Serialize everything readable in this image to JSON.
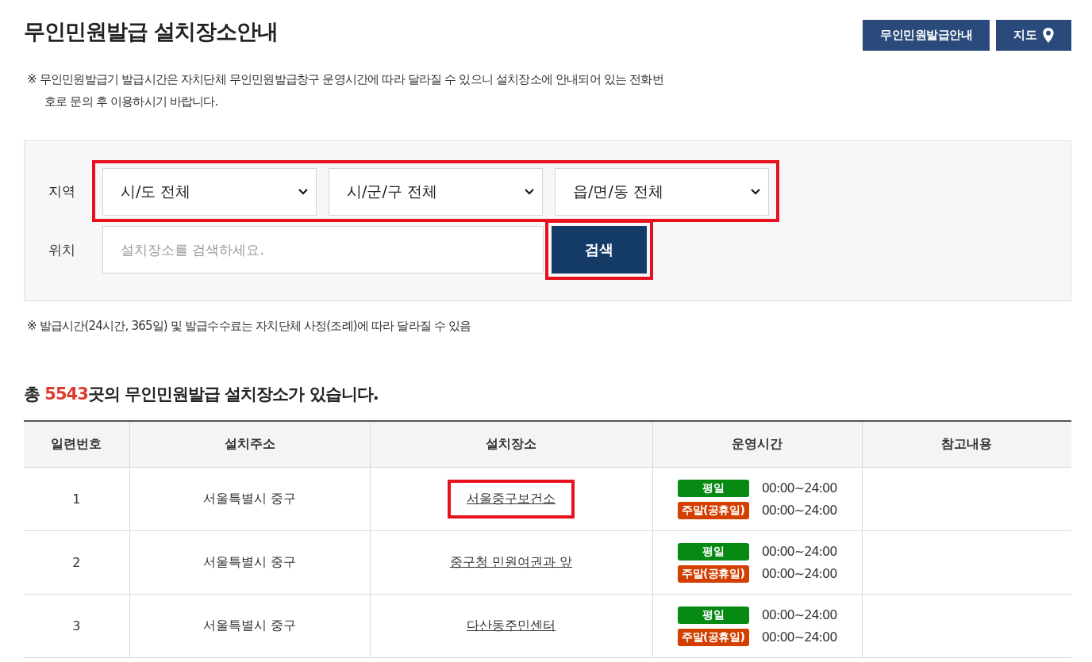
{
  "title": "무인민원발급 설치장소안내",
  "header_buttons": [
    {
      "label": "무인민원발급안내",
      "kind": "text"
    },
    {
      "label": "지도",
      "kind": "map"
    }
  ],
  "notice": "※ 무인민원발급기 발급시간은 자치단체 무인민원발급창구 운영시간에 따라 달라질 수 있으니 설치장소에 안내되어 있는 전화번호로 문의 후 이용하시기 바랍니다.",
  "search": {
    "region_label": "지역",
    "region_highlighted": true,
    "region_selects": [
      {
        "value": "시/도 전체"
      },
      {
        "value": "시/군/구 전체"
      },
      {
        "value": "읍/면/동 전체"
      }
    ],
    "location_label": "위치",
    "location_placeholder": "설치장소를 검색하세요.",
    "button": {
      "label": "검색",
      "highlighted": true
    }
  },
  "footnote": "※ 발급시간(24시간, 365일) 및 발급수수료는 자치단체 사정(조례)에 따라 달라질 수 있음",
  "summary": {
    "prefix": "총",
    "count": "5543",
    "suffix": "곳의 무인민원발급 설치장소가 있습니다."
  },
  "table": {
    "columns": [
      "일련번호",
      "설치주소",
      "설치장소",
      "운영시간",
      "참고내용"
    ],
    "rows": [
      {
        "number": "1",
        "address": "서울특별시 중구",
        "place": "서울중구보건소",
        "place_highlighted": true,
        "hours": [
          {
            "label": "평일",
            "color": "#078a14",
            "time": "00:00~24:00"
          },
          {
            "label": "주말(공휴일)",
            "color": "#d23f00",
            "time": "00:00~24:00"
          }
        ]
      },
      {
        "number": "2",
        "address": "서울특별시 중구",
        "place": "중구청 민원여권과 앞",
        "place_highlighted": false,
        "hours": [
          {
            "label": "평일",
            "color": "#078a14",
            "time": "00:00~24:00"
          },
          {
            "label": "주말(공휴일)",
            "color": "#d23f00",
            "time": "00:00~24:00"
          }
        ]
      },
      {
        "number": "3",
        "address": "서울특별시 중구",
        "place": "다산동주민센터",
        "place_highlighted": false,
        "hours": [
          {
            "label": "평일",
            "color": "#078a14",
            "time": "00:00~24:00"
          },
          {
            "label": "주말(공휴일)",
            "color": "#d23f00",
            "time": "00:00~24:00"
          }
        ]
      }
    ]
  }
}
